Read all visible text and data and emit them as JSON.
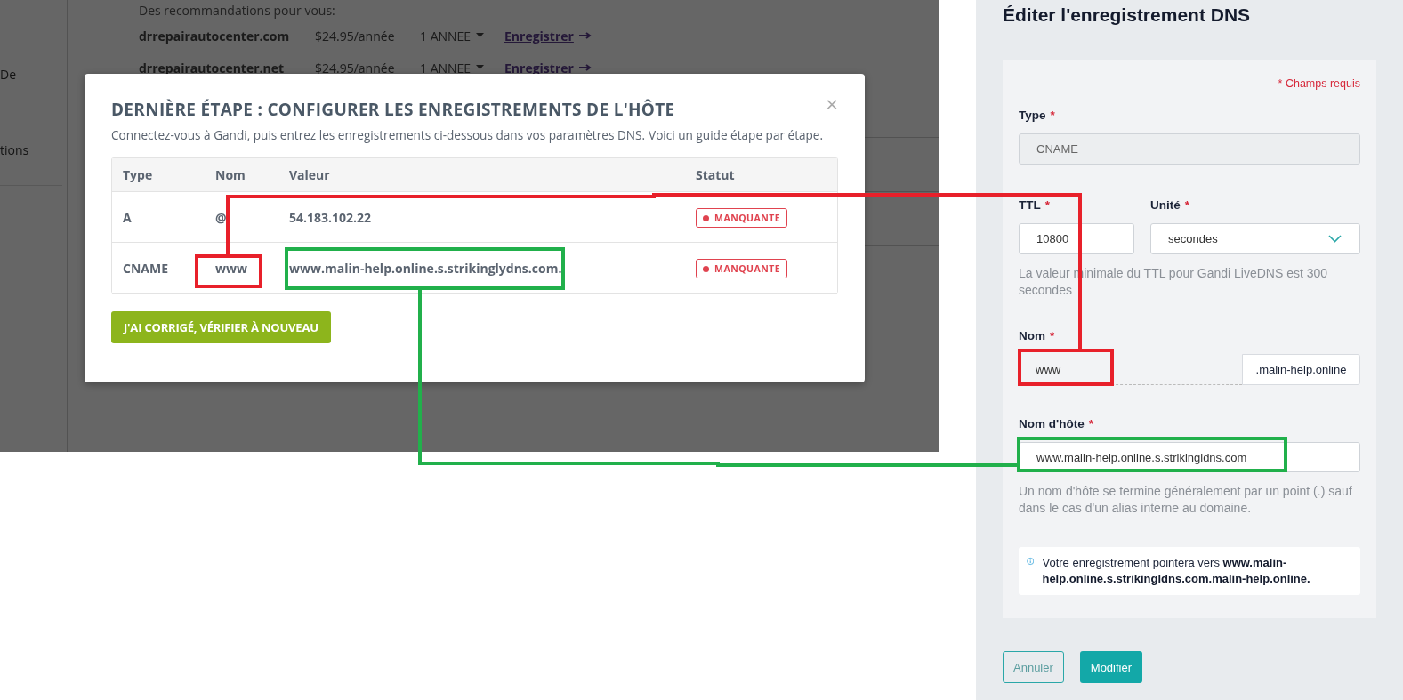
{
  "background_page": {
    "sidebar_items": [
      "De",
      "tions"
    ],
    "recommendations_heading": "Des recommandations pour vous:",
    "recommendations": [
      {
        "domain": "drrepairautocenter.com",
        "price": "$24.95/année",
        "term": "1 ANNEE",
        "action": "Enregistrer"
      },
      {
        "domain": "drrepairautocenter.net",
        "price": "$24.95/année",
        "term": "1 ANNEE",
        "action": "Enregistrer"
      }
    ]
  },
  "modal": {
    "title": "DERNIÈRE ÉTAPE : CONFIGURER LES ENREGISTREMENTS DE L'HÔTE",
    "close": "×",
    "description": "Connectez-vous à Gandi, puis entrez les enregistrements ci-dessous dans vos paramètres DNS.",
    "guide_link": "Voici un guide étape par étape.",
    "table": {
      "columns": [
        "Type",
        "Nom",
        "Valeur",
        "Statut"
      ],
      "rows": [
        {
          "type": "A",
          "name": "@",
          "value": "54.183.102.22",
          "status": "MANQUANTE"
        },
        {
          "type": "CNAME",
          "name": "www",
          "value": "www.malin-help.online.s.strikinglydns.com.",
          "status": "MANQUANTE"
        }
      ]
    },
    "button": "J'AI CORRIGÉ, VÉRIFIER À NOUVEAU"
  },
  "edit_panel": {
    "title": "Éditer l'enregistrement DNS",
    "required_note": "* Champs requis",
    "type_field": {
      "label": "Type",
      "required_mark": "*",
      "value": "CNAME",
      "disabled": true
    },
    "ttl_field": {
      "label": "TTL",
      "required_mark": "*",
      "value": "10800"
    },
    "unit_field": {
      "label": "Unité",
      "required_mark": "*",
      "value": "secondes"
    },
    "ttl_hint": "La valeur minimale du TTL pour Gandi LiveDNS est 300 secondes",
    "name_field": {
      "label": "Nom",
      "required_mark": "*",
      "value": "www",
      "suffix": ".malin-help.online"
    },
    "hostname_field": {
      "label": "Nom d'hôte",
      "required_mark": "*",
      "value": "www.malin-help.online.s.strikingldns.com"
    },
    "hostname_hint": "Un nom d'hôte se termine généralement par un point (.) sauf dans le cas d'un alias interne au domaine.",
    "info": "Votre enregistrement pointera vers **www.malin-help.online.s.strikingldns.com.malin-help.online.**",
    "buttons": [
      "Annuler",
      "Modifier"
    ]
  }
}
